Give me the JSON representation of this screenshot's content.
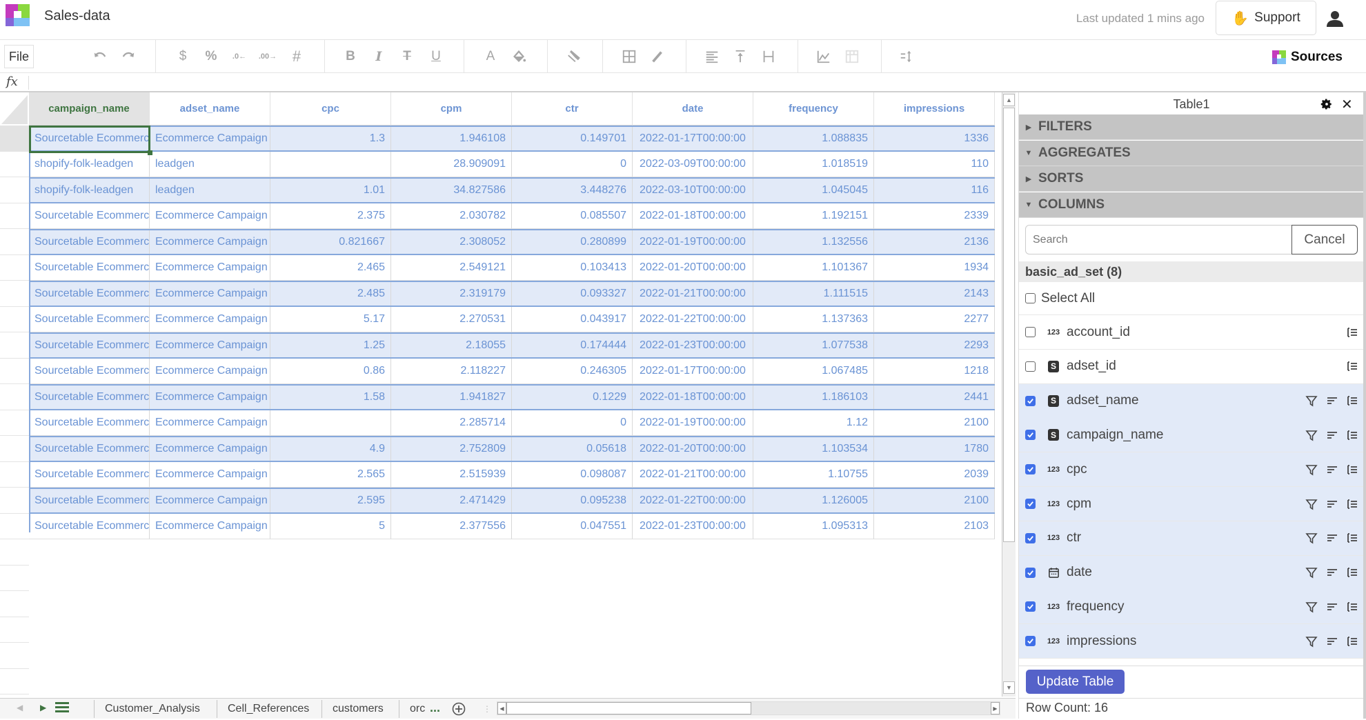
{
  "app": {
    "title": "Sales-data",
    "last_updated": "Last updated 1 mins ago",
    "support_label": "Support",
    "sources_label": "Sources",
    "brand_colors": [
      "#c43bbd",
      "#8ad83f",
      "#8466d8",
      "#7ec2f4"
    ]
  },
  "toolbar": {
    "file_label": "File",
    "formula_label": "fx",
    "formula_value": "",
    "icons": [
      "undo-icon",
      "redo-icon",
      "currency-icon",
      "percent-icon",
      "decrease-decimal-icon",
      "increase-decimal-icon",
      "number-format-icon",
      "bold-icon",
      "italic-icon",
      "strikethrough-icon",
      "underline-icon",
      "text-color-icon",
      "fill-color-icon",
      "clear-format-icon",
      "borders-icon",
      "pen-icon",
      "align-left-icon",
      "vertical-align-top-icon",
      "text-wrap-icon",
      "chart-icon",
      "pivot-table-icon",
      "sort-icon"
    ]
  },
  "grid": {
    "columns": [
      "campaign_name",
      "adset_name",
      "cpc",
      "cpm",
      "ctr",
      "date",
      "frequency",
      "impressions"
    ],
    "numeric_columns": [
      false,
      false,
      true,
      true,
      true,
      false,
      true,
      true
    ],
    "active_column": "campaign_name",
    "rows": [
      [
        "Sourcetable Ecommerce",
        "Ecommerce Campaign",
        "1.3",
        "1.946108",
        "0.149701",
        "2022-01-17T00:00:00",
        "1.088835",
        "1336"
      ],
      [
        "shopify-folk-leadgen",
        "leadgen",
        "",
        "28.909091",
        "0",
        "2022-03-09T00:00:00",
        "1.018519",
        "110"
      ],
      [
        "shopify-folk-leadgen",
        "leadgen",
        "1.01",
        "34.827586",
        "3.448276",
        "2022-03-10T00:00:00",
        "1.045045",
        "116"
      ],
      [
        "Sourcetable Ecommerce",
        "Ecommerce Campaign",
        "2.375",
        "2.030782",
        "0.085507",
        "2022-01-18T00:00:00",
        "1.192151",
        "2339"
      ],
      [
        "Sourcetable Ecommerce",
        "Ecommerce Campaign",
        "0.821667",
        "2.308052",
        "0.280899",
        "2022-01-19T00:00:00",
        "1.132556",
        "2136"
      ],
      [
        "Sourcetable Ecommerce",
        "Ecommerce Campaign",
        "2.465",
        "2.549121",
        "0.103413",
        "2022-01-20T00:00:00",
        "1.101367",
        "1934"
      ],
      [
        "Sourcetable Ecommerce",
        "Ecommerce Campaign",
        "2.485",
        "2.319179",
        "0.093327",
        "2022-01-21T00:00:00",
        "1.111515",
        "2143"
      ],
      [
        "Sourcetable Ecommerce",
        "Ecommerce Campaign",
        "5.17",
        "2.270531",
        "0.043917",
        "2022-01-22T00:00:00",
        "1.137363",
        "2277"
      ],
      [
        "Sourcetable Ecommerce",
        "Ecommerce Campaign",
        "1.25",
        "2.18055",
        "0.174444",
        "2022-01-23T00:00:00",
        "1.077538",
        "2293"
      ],
      [
        "Sourcetable Ecommerce",
        "Ecommerce Campaign",
        "0.86",
        "2.118227",
        "0.246305",
        "2022-01-17T00:00:00",
        "1.067485",
        "1218"
      ],
      [
        "Sourcetable Ecommerce",
        "Ecommerce Campaign",
        "1.58",
        "1.941827",
        "0.1229",
        "2022-01-18T00:00:00",
        "1.186103",
        "2441"
      ],
      [
        "Sourcetable Ecommerce",
        "Ecommerce Campaign",
        "",
        "2.285714",
        "0",
        "2022-01-19T00:00:00",
        "1.12",
        "2100"
      ],
      [
        "Sourcetable Ecommerce",
        "Ecommerce Campaign",
        "4.9",
        "2.752809",
        "0.05618",
        "2022-01-20T00:00:00",
        "1.103534",
        "1780"
      ],
      [
        "Sourcetable Ecommerce",
        "Ecommerce Campaign",
        "2.565",
        "2.515939",
        "0.098087",
        "2022-01-21T00:00:00",
        "1.10755",
        "2039"
      ],
      [
        "Sourcetable Ecommerce",
        "Ecommerce Campaign",
        "2.595",
        "2.471429",
        "0.095238",
        "2022-01-22T00:00:00",
        "1.126005",
        "2100"
      ],
      [
        "Sourcetable Ecommerce",
        "Ecommerce Campaign",
        "5",
        "2.377556",
        "0.047551",
        "2022-01-23T00:00:00",
        "1.095313",
        "2103"
      ]
    ]
  },
  "sheets": {
    "tabs": [
      "Customer_Analysis",
      "Cell_References",
      "customers",
      "orc"
    ],
    "more_label": "..."
  },
  "panel": {
    "title": "Table1",
    "sections": [
      {
        "label": "FILTERS",
        "expanded": false
      },
      {
        "label": "AGGREGATES",
        "expanded": true
      },
      {
        "label": "SORTS",
        "expanded": false
      },
      {
        "label": "COLUMNS",
        "expanded": true
      }
    ],
    "search_placeholder": "Search",
    "search_value": "",
    "cancel_label": "Cancel",
    "group_label": "basic_ad_set (8)",
    "select_all_label": "Select All",
    "select_all_checked": false,
    "columns": [
      {
        "name": "account_id",
        "type": "123",
        "checked": false
      },
      {
        "name": "adset_id",
        "type": "S",
        "checked": false
      },
      {
        "name": "adset_name",
        "type": "S",
        "checked": true
      },
      {
        "name": "campaign_name",
        "type": "S",
        "checked": true
      },
      {
        "name": "cpc",
        "type": "123",
        "checked": true
      },
      {
        "name": "cpm",
        "type": "123",
        "checked": true
      },
      {
        "name": "ctr",
        "type": "123",
        "checked": true
      },
      {
        "name": "date",
        "type": "date",
        "checked": true
      },
      {
        "name": "frequency",
        "type": "123",
        "checked": true
      },
      {
        "name": "impressions",
        "type": "123",
        "checked": true
      }
    ],
    "update_label": "Update Table",
    "row_count": "Row Count: 16"
  }
}
